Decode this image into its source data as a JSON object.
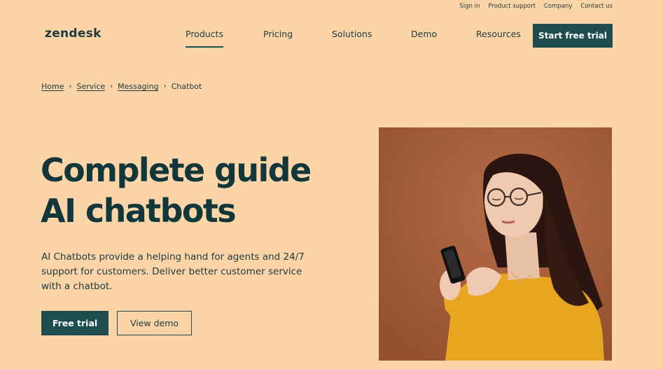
{
  "utility_nav": [
    "Sign in",
    "Product support",
    "Company",
    "Contact us"
  ],
  "brand": {
    "name": "zendesk"
  },
  "main_nav": {
    "items": [
      "Products",
      "Pricing",
      "Solutions",
      "Demo",
      "Resources"
    ],
    "active": "Products",
    "cta": "Start free trial"
  },
  "breadcrumb": {
    "links": [
      "Home",
      "Service",
      "Messaging"
    ],
    "current": "Chatbot"
  },
  "hero": {
    "title_line1": "Complete guide",
    "title_line2": "AI chatbots",
    "description": "AI Chatbots provide a helping hand for agents and 24/7 support for customers. Deliver better customer service with a chatbot.",
    "primary_button": "Free trial",
    "secondary_button": "View demo"
  },
  "colors": {
    "background": "#fbd4a8",
    "primary": "#1f4d4f",
    "text": "#11373a",
    "photo_background": "#a8613f",
    "shirt": "#e8a51f"
  }
}
